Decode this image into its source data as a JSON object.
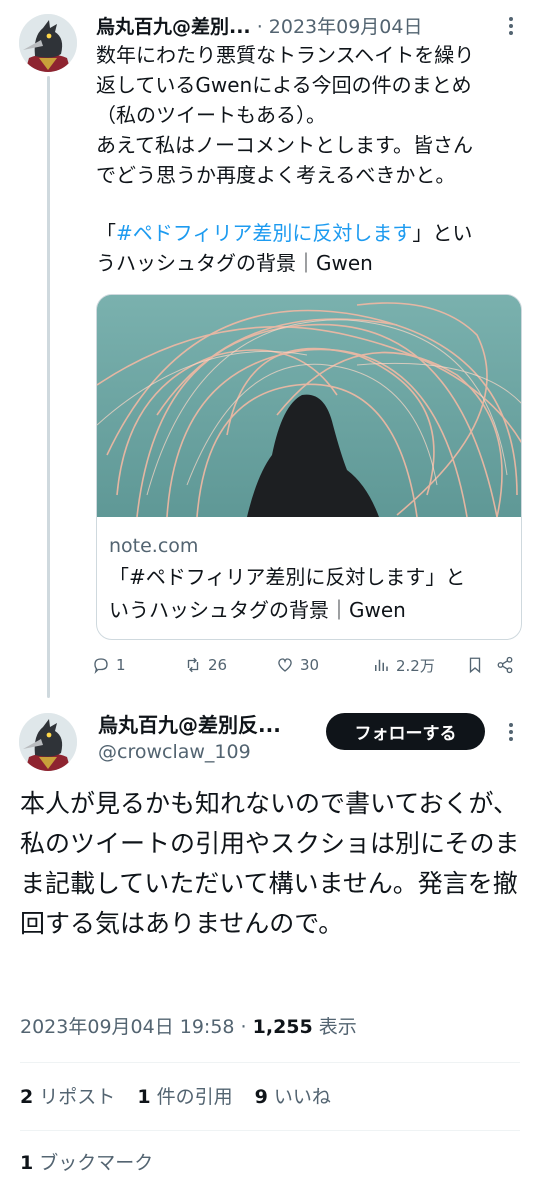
{
  "thread_tweet": {
    "author_name": "烏丸百九@差別...",
    "separator": " · ",
    "date": "2023年09月04日",
    "text_lines": [
      "数年にわたり悪質なトランスヘイトを繰り",
      "返しているGwenによる今回の件のまとめ",
      "（私のツイートもある）。",
      "あえて私はノーコメントとします。皆さん",
      "でどう思うか再度よく考えるべきかと。"
    ],
    "link_open_bracket": "「",
    "hashtag": "#ペドフィリア差別に反対します",
    "link_close_rest": "」とい",
    "link_line2": "うハッシュタグの背景｜Gwen",
    "card": {
      "domain": "note.com",
      "title_line1": "「#ペドフィリア差別に反対します」と",
      "title_line2": "いうハッシュタグの背景｜Gwen"
    },
    "actions": {
      "replies": "1",
      "reposts": "26",
      "likes": "30",
      "views": "2.2万"
    }
  },
  "main_tweet": {
    "author_name": "烏丸百九@差別反...",
    "handle": "@crowclaw_109",
    "follow_label": "フォローする",
    "body": "本人が見るかも知れないので書いておくが、私のツイートの引用やスクショは別にそのまま記載していただいて構いません。発言を撤回する気はありませんので。",
    "timestamp": "2023年09月04日 19:58",
    "dot": " · ",
    "views_count": "1,255",
    "views_label": " 表示",
    "stats": {
      "reposts_count": "2",
      "reposts_label": " リポスト",
      "quotes_count": "1",
      "quotes_label": " 件の引用",
      "likes_count": "9",
      "likes_label": " いいね"
    },
    "bookmarks_count": "1",
    "bookmarks_label": " ブックマーク"
  },
  "icons": [
    "avatar-crow",
    "more-icon",
    "reply-icon",
    "repost-icon",
    "like-icon",
    "views-icon",
    "bookmark-icon",
    "share-icon"
  ],
  "colors": {
    "link": "#1d9bf0",
    "text": "#0f1419",
    "muted": "#536471",
    "button": "#0f1419"
  }
}
